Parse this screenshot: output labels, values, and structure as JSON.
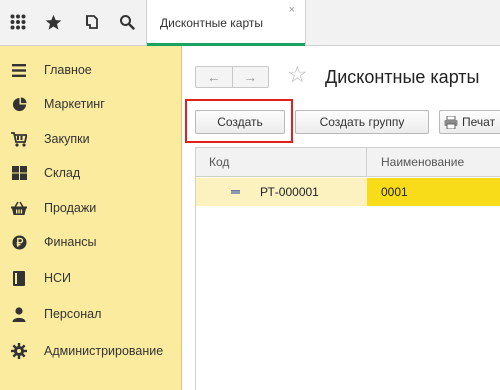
{
  "topbar": {
    "tab_label": "Дисконтные карты",
    "tab_close": "×",
    "icons": [
      "apps-grid-icon",
      "star-icon",
      "history-icon",
      "search-icon"
    ]
  },
  "sidebar": {
    "items": [
      {
        "label": "Главное",
        "icon": "menu-lines-icon"
      },
      {
        "label": "Маркетинг",
        "icon": "pie-chart-icon"
      },
      {
        "label": "Закупки",
        "icon": "cart-icon"
      },
      {
        "label": "Склад",
        "icon": "warehouse-grid-icon"
      },
      {
        "label": "Продажи",
        "icon": "basket-icon"
      },
      {
        "label": "Финансы",
        "icon": "ruble-icon"
      },
      {
        "label": "НСИ",
        "icon": "reference-book-icon"
      },
      {
        "label": "Персонал",
        "icon": "person-icon"
      },
      {
        "label": "Администрирование",
        "icon": "gear-icon"
      }
    ],
    "background": "#fbeb9e"
  },
  "main": {
    "title": "Дисконтные карты",
    "back_arrow": "←",
    "forward_arrow": "→",
    "star": "☆",
    "buttons": {
      "create": "Создать",
      "create_group": "Создать группу",
      "print": "Печат"
    },
    "table": {
      "columns": [
        "Код",
        "Наименование"
      ],
      "rows": [
        {
          "code": "РТ-000001",
          "name": "0001"
        }
      ]
    },
    "highlight_color": "#e0201e",
    "selected_cell_color": "#f8dc1a"
  }
}
